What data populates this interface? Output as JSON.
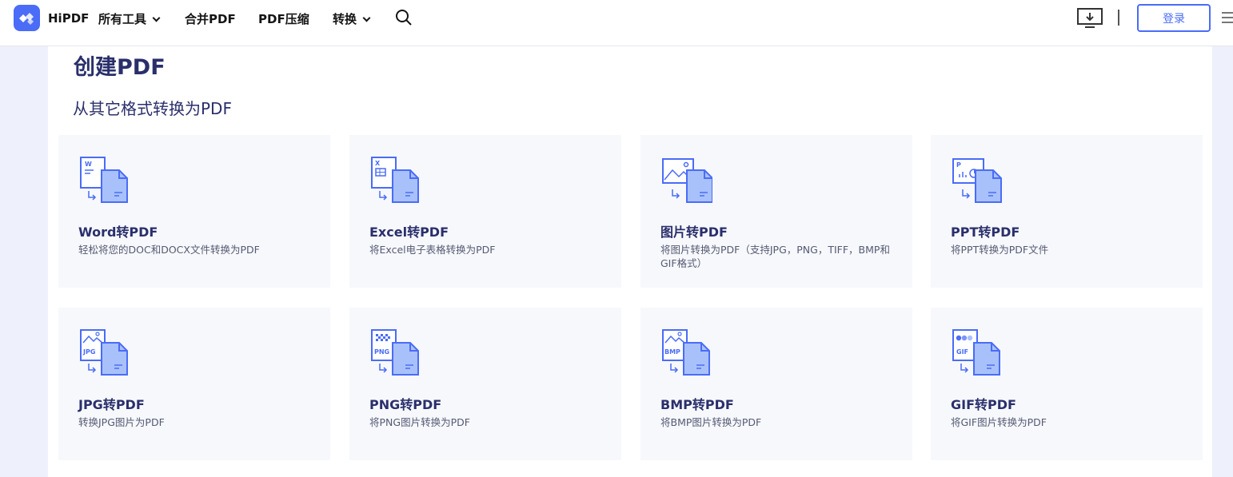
{
  "header": {
    "brand": "HiPDF",
    "nav": [
      {
        "label": "所有工具",
        "has_dropdown": true
      },
      {
        "label": "合并PDF",
        "has_dropdown": false
      },
      {
        "label": "PDF压缩",
        "has_dropdown": false
      },
      {
        "label": "转换",
        "has_dropdown": true
      }
    ],
    "login_label": "登录"
  },
  "main": {
    "title": "创建PDF",
    "subtitle": "从其它格式转换为PDF",
    "tools": [
      {
        "icon": "word-doc-icon",
        "badge": "W",
        "title": "Word转PDF",
        "desc": "轻松将您的DOC和DOCX文件转换为PDF"
      },
      {
        "icon": "excel-doc-icon",
        "badge": "X",
        "title": "Excel转PDF",
        "desc": "将Excel电子表格转换为PDF"
      },
      {
        "icon": "image-doc-icon",
        "badge": "",
        "title": "图片转PDF",
        "desc": "将图片转换为PDF（支持JPG，PNG，TIFF，BMP和GIF格式）"
      },
      {
        "icon": "ppt-doc-icon",
        "badge": "P",
        "title": "PPT转PDF",
        "desc": "将PPT转换为PDF文件"
      },
      {
        "icon": "jpg-doc-icon",
        "badge": "JPG",
        "title": "JPG转PDF",
        "desc": "转换JPG图片为PDF"
      },
      {
        "icon": "png-doc-icon",
        "badge": "PNG",
        "title": "PNG转PDF",
        "desc": "将PNG图片转换为PDF"
      },
      {
        "icon": "bmp-doc-icon",
        "badge": "BMP",
        "title": "BMP转PDF",
        "desc": "将BMP图片转换为PDF"
      },
      {
        "icon": "gif-doc-icon",
        "badge": "GIF",
        "title": "GIF转PDF",
        "desc": "将GIF图片转换为PDF"
      }
    ]
  },
  "colors": {
    "accent": "#4a6cf7",
    "title": "#2a2f6b",
    "card_bg": "#f7f8fc",
    "page_bg": "#eef0fb"
  }
}
